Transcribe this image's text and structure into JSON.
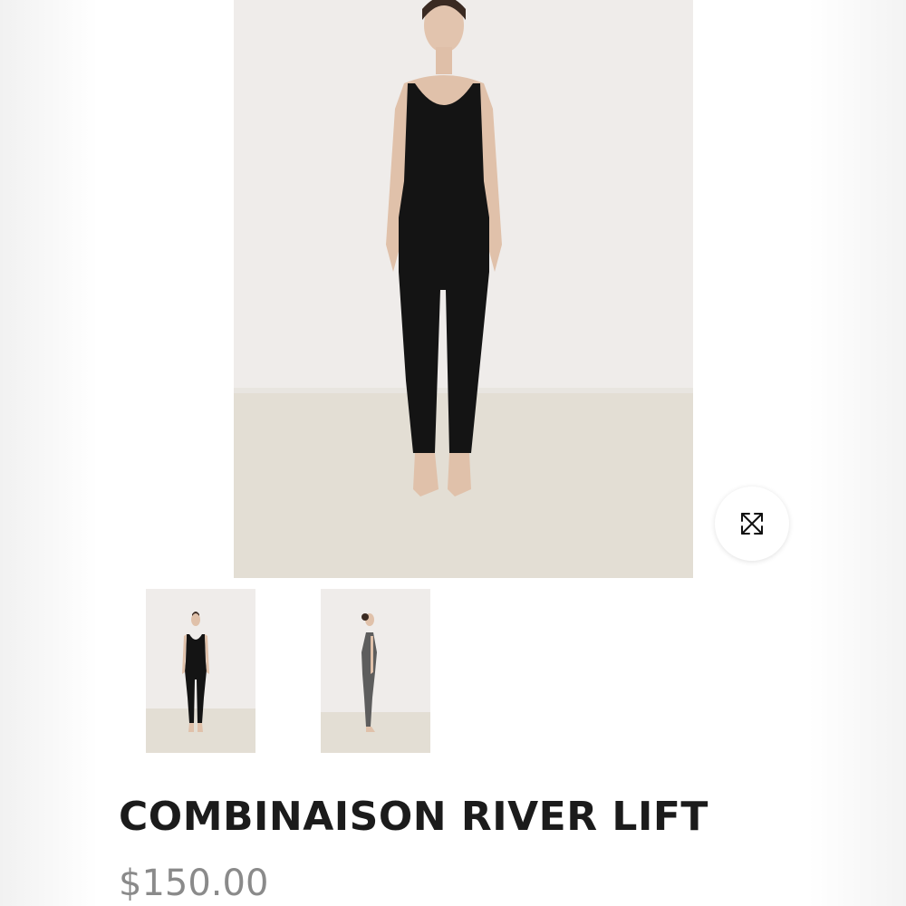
{
  "product": {
    "title": "COMBINAISON RIVER LIFT",
    "price": "$150.00"
  },
  "gallery": {
    "main_image_alt": "Model wearing black full-length jumpsuit, front view",
    "zoom_icon": "expand-arrows-icon",
    "thumbnails": [
      {
        "alt": "Front view black jumpsuit"
      },
      {
        "alt": "Side view grey jumpsuit"
      }
    ]
  },
  "colors": {
    "title": "#1b1b1b",
    "price": "#8a8a8a",
    "wall": "#efecea",
    "floor": "#e2ddd2",
    "garment_black": "#141414",
    "garment_grey": "#5d5d5d"
  }
}
